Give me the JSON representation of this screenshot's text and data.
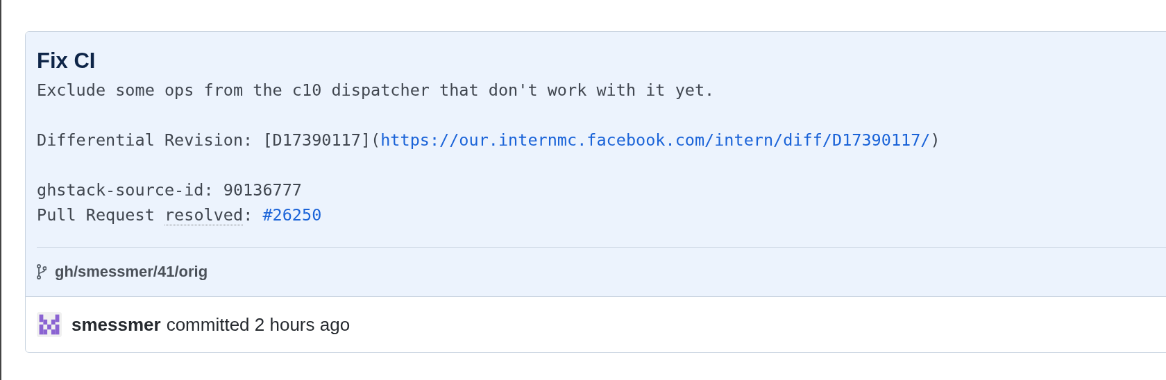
{
  "commit": {
    "title": "Fix CI",
    "message": [
      [
        [
          {
            "kind": "text",
            "text": "Exclude some ops from the c10 dispatcher that don't work with it yet."
          }
        ]
      ],
      [
        [
          {
            "kind": "text",
            "text": "Differential Revision: [D17390117]("
          },
          {
            "kind": "link",
            "text": "https://our.internmc.facebook.com/intern/diff/D17390117/"
          },
          {
            "kind": "text",
            "text": ")"
          }
        ]
      ],
      [
        [
          {
            "kind": "text",
            "text": "ghstack-source-id: 90136777"
          }
        ],
        [
          {
            "kind": "text",
            "text": "Pull Request "
          },
          {
            "kind": "abbr",
            "text": "resolved"
          },
          {
            "kind": "text",
            "text": ": "
          },
          {
            "kind": "link",
            "text": "#26250"
          }
        ]
      ]
    ],
    "branch": "gh/smessmer/41/orig",
    "author": "smessmer",
    "action": "committed 2 hours ago"
  }
}
